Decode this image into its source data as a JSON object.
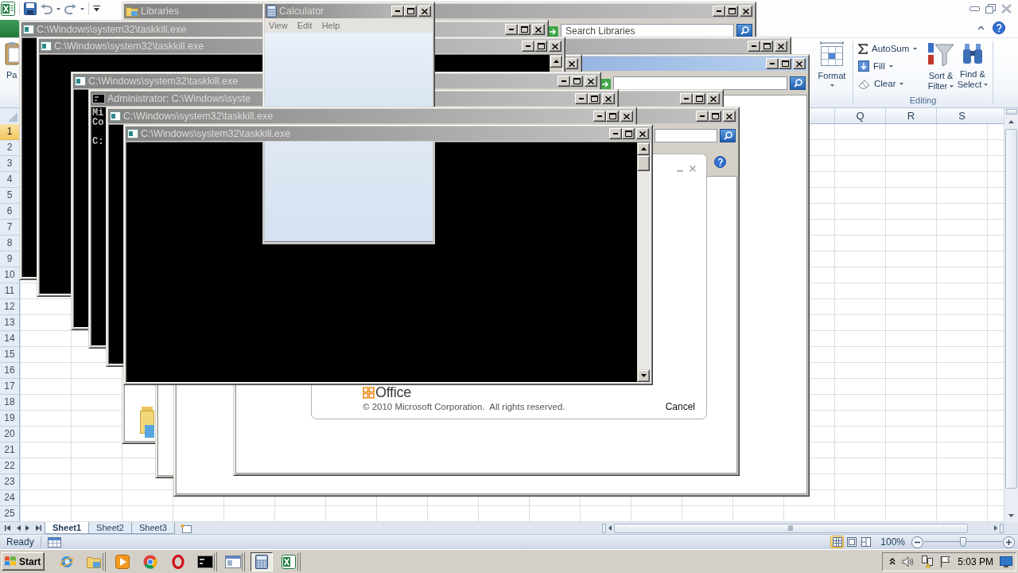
{
  "excel": {
    "ribbon": {
      "paste_label": "Pa",
      "format_label": "Format",
      "editing_commands": [
        {
          "label": "AutoSum"
        },
        {
          "label": "Fill"
        },
        {
          "label": "Clear"
        }
      ],
      "editing_buttons": [
        {
          "lines": [
            "Sort &",
            "Filter"
          ]
        },
        {
          "lines": [
            "Find &",
            "Select"
          ]
        }
      ],
      "editing_group_label": "Editing"
    },
    "column_headers": [
      "Q",
      "R",
      "S"
    ],
    "row_headers": [
      {
        "label": "1",
        "selected": true
      },
      {
        "label": "2",
        "selected": false
      },
      {
        "label": "3",
        "selected": false
      },
      {
        "label": "4",
        "selected": false
      },
      {
        "label": "5",
        "selected": false
      },
      {
        "label": "6",
        "selected": false
      },
      {
        "label": "7",
        "selected": false
      },
      {
        "label": "8",
        "selected": false
      },
      {
        "label": "9",
        "selected": false
      },
      {
        "label": "10",
        "selected": false
      },
      {
        "label": "11",
        "selected": false
      },
      {
        "label": "12",
        "selected": false
      },
      {
        "label": "13",
        "selected": false
      },
      {
        "label": "14",
        "selected": false
      },
      {
        "label": "15",
        "selected": false
      },
      {
        "label": "16",
        "selected": false
      },
      {
        "label": "17",
        "selected": false
      },
      {
        "label": "18",
        "selected": false
      },
      {
        "label": "19",
        "selected": false
      },
      {
        "label": "20",
        "selected": false
      },
      {
        "label": "21",
        "selected": false
      },
      {
        "label": "22",
        "selected": false
      },
      {
        "label": "23",
        "selected": false
      },
      {
        "label": "24",
        "selected": false
      },
      {
        "label": "25",
        "selected": false
      }
    ],
    "sheet_tabs": [
      {
        "label": "Sheet1",
        "selected": true
      },
      {
        "label": "Sheet2",
        "selected": false
      },
      {
        "label": "Sheet3",
        "selected": false
      }
    ],
    "status_bar": {
      "status": "Ready",
      "views": [
        {
          "selected": true
        },
        {
          "selected": false
        },
        {
          "selected": false
        }
      ],
      "zoom": {
        "reading": "100%",
        "level": 0.5
      }
    }
  },
  "windows": [
    {
      "kind": "explorer",
      "title": "Libraries",
      "active": false,
      "search_box": true,
      "search_placeholder": "Search Libraries",
      "library_icon": true
    },
    {
      "kind": "console",
      "title": "C:\\Windows\\system32\\taskkill.exe",
      "active": false
    },
    {
      "kind": "explorer",
      "active": false
    },
    {
      "kind": "explorer",
      "active": true,
      "search_box": true
    },
    {
      "kind": "explorer",
      "active": false
    },
    {
      "kind": "console",
      "title": "C:\\Windows\\system32\\taskkill.exe",
      "active": false
    },
    {
      "kind": "console",
      "title": "C:\\Windows\\system32\\taskkill.exe",
      "active": false
    },
    {
      "kind": "explorer",
      "active": false
    },
    {
      "kind": "shell",
      "title": "Administrator: C:\\Windows\\syste",
      "active": false,
      "lines": [
        {
          "text": "Mi",
          "kind": "output"
        },
        {
          "text": "Co",
          "kind": "output"
        },
        {
          "text": "C:",
          "kind": "prompt"
        }
      ]
    },
    {
      "kind": "explorer",
      "active": false,
      "search_box": true,
      "help_button": true
    },
    {
      "kind": "dialog",
      "logo_text": "Office",
      "copyright": "© 2010 Microsoft Corporation.  All rights reserved.",
      "button": "Cancel"
    },
    {
      "kind": "calculator",
      "title": "Calculator",
      "active": false,
      "menu": [
        {
          "label": "View"
        },
        {
          "label": "Edit"
        },
        {
          "label": "Help"
        }
      ]
    },
    {
      "kind": "console",
      "title": "C:\\Windows\\system32\\taskkill.exe",
      "active": false
    },
    {
      "kind": "console",
      "title": "C:\\Windows\\system32\\taskkill.exe",
      "active": false
    }
  ],
  "taskbar": {
    "start_label": "Start",
    "items": [
      {
        "kind": "ie",
        "selected": false
      },
      {
        "kind": "folder",
        "selected": false
      },
      {
        "kind": "player",
        "selected": false
      },
      {
        "kind": "chrome",
        "selected": false
      },
      {
        "kind": "opera",
        "selected": false
      },
      {
        "kind": "console",
        "selected": false
      },
      {
        "kind": "window",
        "selected": false
      },
      {
        "kind": "calculator",
        "selected": true
      },
      {
        "kind": "spreadsheet",
        "selected": false
      }
    ],
    "clock": "5:03 PM"
  }
}
